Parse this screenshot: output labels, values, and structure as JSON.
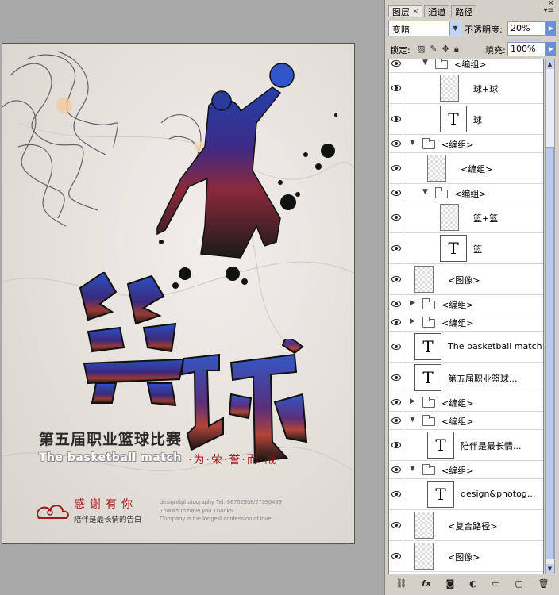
{
  "poster": {
    "char_lan": "篮",
    "char_qiu": "球",
    "title_cn": "第五届职业篮球比赛",
    "title_en": "The basketball match",
    "slogan": "·为·荣·誉·而·战·",
    "thanks": "感谢有你",
    "motto": "陪伴是最长情的告白",
    "credit_line1": "design&photography Tel:-98752958/27396499",
    "credit_line2": "Thanks to have you  Thanks",
    "credit_line3": "Company is the longest confession of love"
  },
  "panel": {
    "tabs": [
      "图层",
      "通道",
      "路径"
    ],
    "blend_mode": "变暗",
    "opacity_label": "不透明度:",
    "opacity_value": "20%",
    "lock_label": "锁定:",
    "fill_label": "填充:",
    "fill_value": "100%"
  },
  "layers": [
    {
      "type": "group",
      "name": "<编组>",
      "indent": 1,
      "expanded": true
    },
    {
      "type": "image",
      "name": "球+球",
      "indent": 2
    },
    {
      "type": "text",
      "name": "球",
      "indent": 2
    },
    {
      "type": "group",
      "name": "<编组>",
      "indent": 0,
      "expanded": true
    },
    {
      "type": "image",
      "name": "<编组>",
      "indent": 1
    },
    {
      "type": "group",
      "name": "<编组>",
      "indent": 1,
      "expanded": true
    },
    {
      "type": "image",
      "name": "篮+篮",
      "indent": 2
    },
    {
      "type": "text",
      "name": "篮",
      "indent": 2
    },
    {
      "type": "image",
      "name": "<图像>",
      "indent": 0
    },
    {
      "type": "group",
      "name": "<编组>",
      "indent": 0,
      "expanded": false
    },
    {
      "type": "group",
      "name": "<编组>",
      "indent": 0,
      "expanded": false
    },
    {
      "type": "text",
      "name": "The basketball match",
      "indent": 0
    },
    {
      "type": "text",
      "name": "第五届职业篮球...",
      "indent": 0
    },
    {
      "type": "group",
      "name": "<编组>",
      "indent": 0,
      "expanded": false
    },
    {
      "type": "group",
      "name": "<编组>",
      "indent": 0,
      "expanded": true
    },
    {
      "type": "text",
      "name": "陪伴是最长情...",
      "indent": 1
    },
    {
      "type": "group",
      "name": "<编组>",
      "indent": 0,
      "expanded": true
    },
    {
      "type": "text",
      "name": "design&photog...",
      "indent": 1
    },
    {
      "type": "image",
      "name": "<复合路径>",
      "indent": 0
    },
    {
      "type": "image",
      "name": "<图像>",
      "indent": 0
    }
  ],
  "icons": {
    "link": "link-icon",
    "fx": "fx",
    "mask": "mask-icon",
    "adjust": "adjustment-icon",
    "folder": "new-group-icon",
    "new_layer": "new-layer-icon",
    "trash": "trash-icon"
  }
}
